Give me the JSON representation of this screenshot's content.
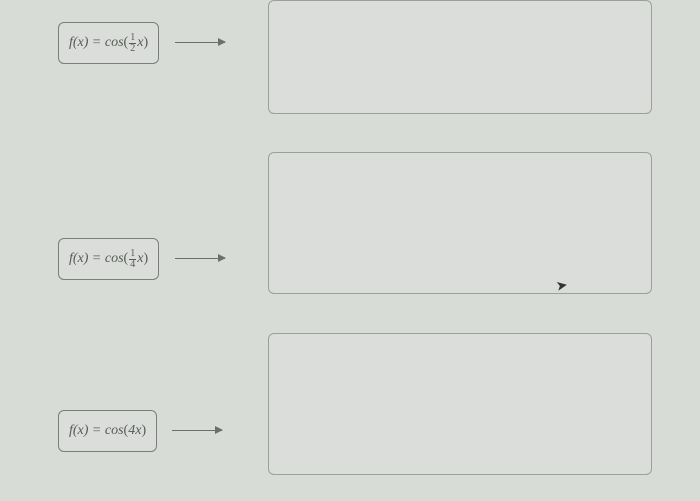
{
  "rows": [
    {
      "label_prefix": "f(x) = cos",
      "has_fraction": true,
      "frac_num": "1",
      "frac_den": "2",
      "var": "x"
    },
    {
      "label_prefix": "f(x) = cos",
      "has_fraction": true,
      "frac_num": "1",
      "frac_den": "4",
      "var": "x"
    },
    {
      "label_prefix": "f(x) = cos",
      "has_fraction": false,
      "inner": "4x"
    }
  ]
}
